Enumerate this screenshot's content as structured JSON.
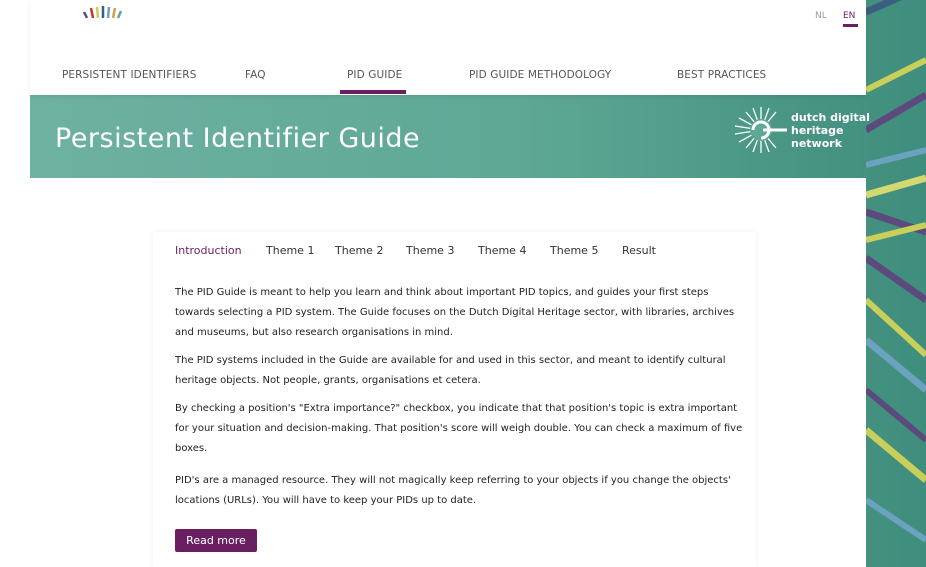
{
  "lang": {
    "nl": "NL",
    "en": "EN"
  },
  "nav": [
    {
      "label": "PERSISTENT IDENTIFIERS"
    },
    {
      "label": "FAQ"
    },
    {
      "label": "PID GUIDE"
    },
    {
      "label": "PID GUIDE METHODOLOGY"
    },
    {
      "label": "BEST PRACTICES"
    }
  ],
  "hero": {
    "title": "Persistent Identifier Guide"
  },
  "brand": {
    "line1": "dutch digital",
    "line2": "heritage",
    "line3": "network"
  },
  "tabs": [
    {
      "label": "Introduction"
    },
    {
      "label": "Theme 1"
    },
    {
      "label": "Theme 2"
    },
    {
      "label": "Theme 3"
    },
    {
      "label": "Theme 4"
    },
    {
      "label": "Theme 5"
    },
    {
      "label": "Result"
    }
  ],
  "content": {
    "p1": "The PID Guide is meant to help you learn and think about important PID topics, and guides your first steps towards selecting a PID system. The Guide focuses on the Dutch Digital Heritage sector, with libraries, archives and museums, but also research organisations in mind.",
    "p2": "The PID systems included in the Guide are available for and used in this sector, and meant to identify cultural heritage objects. Not people, grants, organisations et cetera.",
    "p3": "By checking a position's \"Extra importance?\" checkbox, you indicate that that position's topic is extra important for your situation and decision-making. That position's score will weigh double. You can check a maximum of five boxes.",
    "p4": "PID's are a managed resource. They will not magically keep referring to your objects if you change the objects' locations (URLs). You will have to keep your PIDs up to date.",
    "read_more": "Read more"
  },
  "colors": {
    "accent": "#6b1f63",
    "teal": "#5fa896"
  }
}
